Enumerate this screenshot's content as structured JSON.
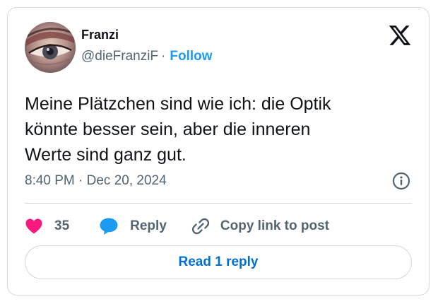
{
  "author": {
    "name": "Franzi",
    "handle": "@dieFranziF",
    "separator": "·",
    "follow_label": "Follow"
  },
  "tweet": {
    "lines": [
      "Meine Plätzchen sind wie ich: die Optik",
      "könnte besser sein, aber die inneren",
      "Werte sind ganz gut."
    ],
    "timestamp": "8:40 PM · Dec 20, 2024"
  },
  "actions": {
    "like_count": "35",
    "reply_label": "Reply",
    "copy_link_label": "Copy link to post"
  },
  "read_reply_label": "Read 1 reply",
  "icons": {
    "logo": "x-logo-icon",
    "info": "info-icon",
    "like": "heart-icon",
    "reply": "speech-bubble-icon",
    "copy": "link-icon"
  },
  "colors": {
    "accent": "#1d9bf0",
    "like": "#f91880",
    "read_reply_text": "#006fd6",
    "secondary_text": "#536471",
    "border": "#cfd9de"
  }
}
